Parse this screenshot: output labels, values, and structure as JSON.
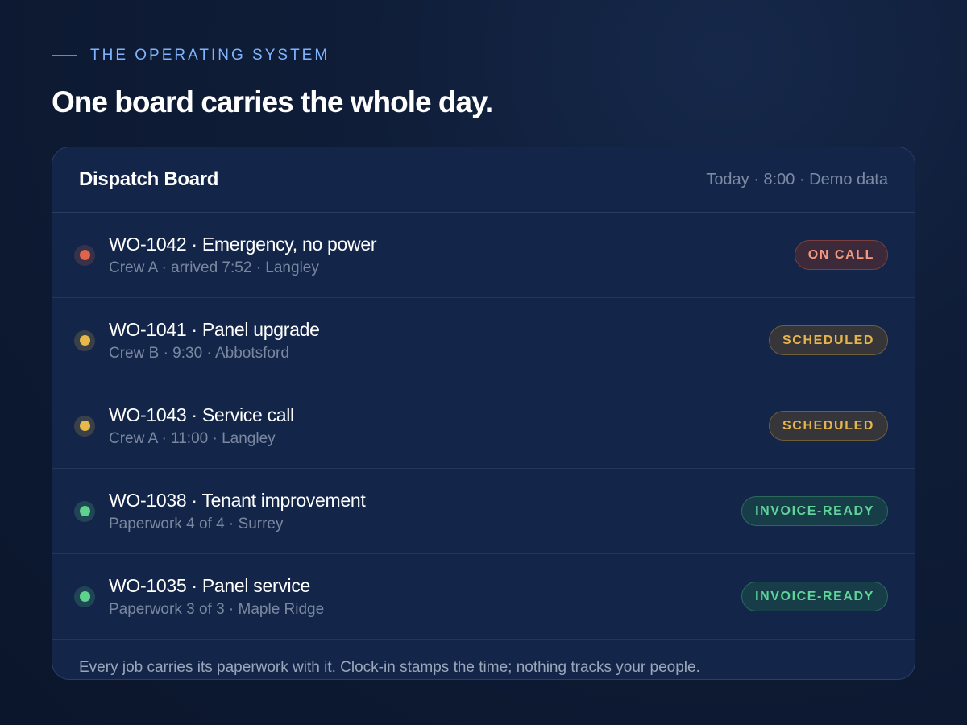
{
  "eyebrow": {
    "text": "THE OPERATING SYSTEM",
    "line_color": "#d8674a",
    "text_color": "#7fb3ff"
  },
  "headline": "One board carries the whole day.",
  "board": {
    "title": "Dispatch Board",
    "meta": "Today · 8:00 · Demo data",
    "rows": [
      {
        "title": "WO-1042 · Emergency, no power",
        "subtitle": "Crew A · arrived 7:52 · Langley",
        "status": "ON CALL",
        "dot_icon": "status-dot-red-icon",
        "dot_color": "#e0644a",
        "badge_text_color": "#f19a80",
        "badge_bg": "#3c2a3a",
        "badge_border": "#7a3f3e"
      },
      {
        "title": "WO-1041 · Panel upgrade",
        "subtitle": "Crew B · 9:30 · Abbotsford",
        "status": "SCHEDULED",
        "dot_icon": "status-dot-yellow-icon",
        "dot_color": "#e7b94a",
        "badge_text_color": "#e6b44d",
        "badge_bg": "#35353a",
        "badge_border": "#6e5e3a"
      },
      {
        "title": "WO-1043 · Service call",
        "subtitle": "Crew A · 11:00 · Langley",
        "status": "SCHEDULED",
        "dot_icon": "status-dot-yellow-icon",
        "dot_color": "#e7b94a",
        "badge_text_color": "#e6b44d",
        "badge_bg": "#35353a",
        "badge_border": "#6e5e3a"
      },
      {
        "title": "WO-1038 · Tenant improvement",
        "subtitle": "Paperwork 4 of 4 · Surrey",
        "status": "INVOICE-READY",
        "dot_icon": "status-dot-green-icon",
        "dot_color": "#5fd38d",
        "badge_text_color": "#5fd39a",
        "badge_bg": "#173e48",
        "badge_border": "#2b6a5c"
      },
      {
        "title": "WO-1035 · Panel service",
        "subtitle": "Paperwork 3 of 3 · Maple Ridge",
        "status": "INVOICE-READY",
        "dot_icon": "status-dot-green-icon",
        "dot_color": "#5fd38d",
        "badge_text_color": "#5fd39a",
        "badge_bg": "#173e48",
        "badge_border": "#2b6a5c"
      }
    ],
    "footer": "Every job carries its paperwork with it. Clock-in stamps the time; nothing tracks your people."
  }
}
